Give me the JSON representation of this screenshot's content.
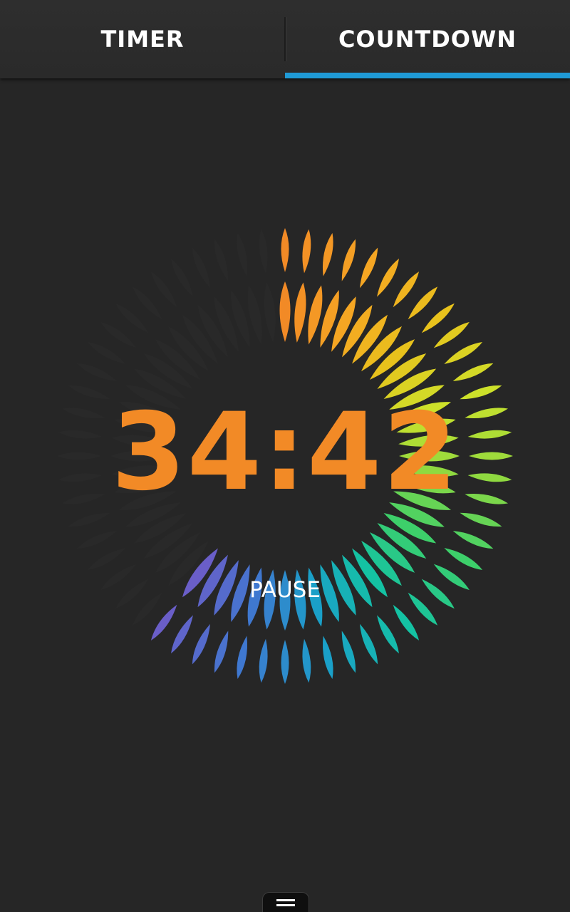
{
  "tabs": [
    {
      "label": "TIMER",
      "active": false
    },
    {
      "label": "COUNTDOWN",
      "active": true
    }
  ],
  "countdown": {
    "time": "34:42",
    "pause_label": "PAUSE",
    "remaining_fraction": 0.62
  },
  "colors": {
    "accent": "#1f9ad6",
    "time_text": "#f28a26",
    "background": "#262626",
    "gradient_stops": [
      "#f28a26",
      "#f5a623",
      "#e8c21c",
      "#cde12a",
      "#8fd940",
      "#3dcf6a",
      "#14c2a3",
      "#1aa0c8",
      "#3f78d0",
      "#6a5ec8"
    ]
  },
  "icons": {
    "menu_handle": "menu-lines-icon"
  }
}
